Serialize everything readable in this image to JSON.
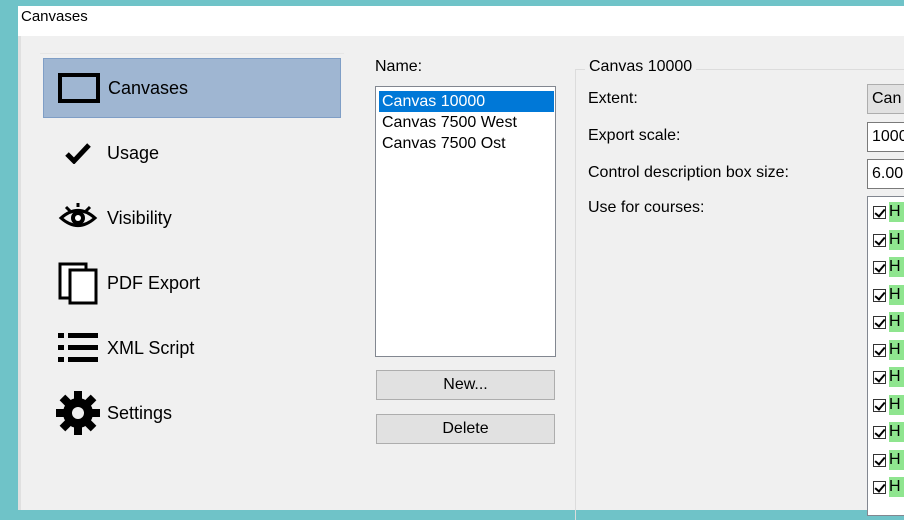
{
  "window": {
    "title": "Canvases"
  },
  "nav": {
    "items": [
      {
        "label": "Canvases",
        "icon": "canvas-rectangle-icon",
        "selected": true
      },
      {
        "label": "Usage",
        "icon": "checkmark-icon",
        "selected": false
      },
      {
        "label": "Visibility",
        "icon": "eye-icon",
        "selected": false
      },
      {
        "label": "PDF Export",
        "icon": "pages-icon",
        "selected": false
      },
      {
        "label": "XML Script",
        "icon": "list-icon",
        "selected": false
      },
      {
        "label": "Settings",
        "icon": "gear-icon",
        "selected": false
      }
    ]
  },
  "canvases": {
    "name_label": "Name:",
    "items": [
      "Canvas 10000",
      "Canvas 7500 West",
      "Canvas 7500 Ost"
    ],
    "selected_index": 0,
    "new_button": "New...",
    "delete_button": "Delete"
  },
  "details": {
    "group_title": "Canvas 10000",
    "extent_label": "Extent:",
    "extent_value": "Can",
    "export_scale_label": "Export scale:",
    "export_scale_value": "1000",
    "box_size_label": "Control description box size:",
    "box_size_value": "6.00",
    "use_for_courses_label": "Use for courses:",
    "courses": [
      {
        "label": "H",
        "checked": true
      },
      {
        "label": "H",
        "checked": true
      },
      {
        "label": "H",
        "checked": true
      },
      {
        "label": "H",
        "checked": true
      },
      {
        "label": "H",
        "checked": true
      },
      {
        "label": "H",
        "checked": true
      },
      {
        "label": "H",
        "checked": true
      },
      {
        "label": "H",
        "checked": true
      },
      {
        "label": "H",
        "checked": true
      },
      {
        "label": "H",
        "checked": true
      },
      {
        "label": "H",
        "checked": true
      }
    ]
  },
  "colors": {
    "background": "#6fc3c8",
    "selection": "#0078d7",
    "nav_selected": "#9fb6d2",
    "course_highlight": "#8fe58f"
  }
}
